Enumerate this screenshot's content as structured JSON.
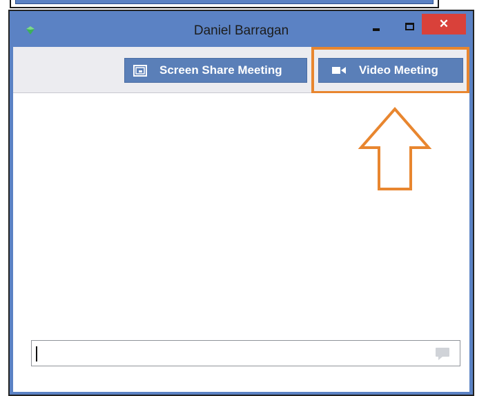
{
  "window": {
    "title": "Daniel Barragan",
    "close_glyph": "✕"
  },
  "toolbar": {
    "screen_share_label": "Screen Share Meeting",
    "video_meeting_label": "Video Meeting"
  },
  "chat": {
    "input_value": "",
    "placeholder": ""
  },
  "icons": {
    "app": "green-gem-icon",
    "screen_share": "screen-share-icon",
    "video": "video-camera-icon",
    "send": "chat-bubble-icon",
    "annotation": "up-arrow-icon"
  },
  "colors": {
    "titlebar": "#5b82c4",
    "button": "#5a7fb8",
    "close": "#d9413a",
    "highlight": "#e8862f",
    "toolbar_bg": "#ececf0"
  }
}
